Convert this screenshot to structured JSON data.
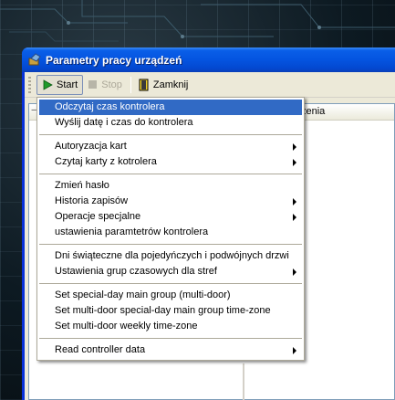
{
  "window": {
    "title": "Parametry pracy urządzeń"
  },
  "toolbar": {
    "start_label": "Start",
    "stop_label": "Stop",
    "close_label": "Zamknij"
  },
  "list": {
    "header_partial": "zenia",
    "collapse_glyph": "−"
  },
  "menu": {
    "group1": [
      {
        "label": "Odczytaj czas kontrolera",
        "submenu": false,
        "selected": true
      },
      {
        "label": "Wyślij datę i czas do kontrolera",
        "submenu": false
      }
    ],
    "group2": [
      {
        "label": "Autoryzacja kart",
        "submenu": true
      },
      {
        "label": "Czytaj karty z kotrolera",
        "submenu": true
      }
    ],
    "group3": [
      {
        "label": "Zmień hasło",
        "submenu": false
      },
      {
        "label": "Historia zapisów",
        "submenu": true
      },
      {
        "label": "Operacje specjalne",
        "submenu": true
      },
      {
        "label": "ustawienia paramtetrów kontrolera",
        "submenu": false
      }
    ],
    "group4": [
      {
        "label": "Dni świąteczne dla pojedyńczych i podwójnych drzwi",
        "submenu": false
      },
      {
        "label": "Ustawienia grup czasowych dla stref",
        "submenu": true
      }
    ],
    "group5": [
      {
        "label": "Set special-day main group (multi-door)",
        "submenu": false
      },
      {
        "label": "Set multi-door  special-day main group time-zone",
        "submenu": false
      },
      {
        "label": "Set multi-door weekly time-zone",
        "submenu": false
      }
    ],
    "group6": [
      {
        "label": "Read  controller data",
        "submenu": true
      }
    ]
  },
  "colors": {
    "titlebar": "#0454e0",
    "menu_highlight": "#316ac5",
    "window_face": "#ece9d8"
  }
}
